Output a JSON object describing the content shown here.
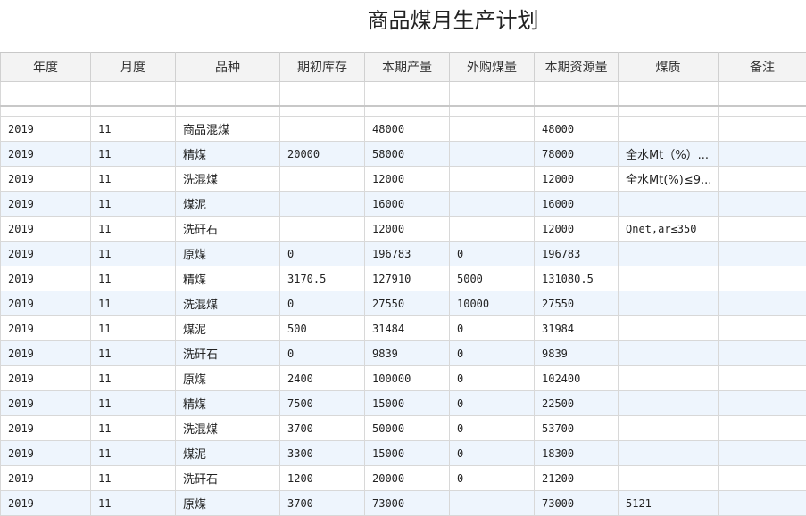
{
  "title": "商品煤月生产计划",
  "columns": [
    "年度",
    "月度",
    "品种",
    "期初库存",
    "本期产量",
    "外购煤量",
    "本期资源量",
    "煤质",
    "备注"
  ],
  "rows": [
    [
      "2019",
      "11",
      "商品混煤",
      "",
      "48000",
      "",
      "48000",
      "",
      ""
    ],
    [
      "2019",
      "11",
      "精煤",
      "20000",
      "58000",
      "",
      "78000",
      "全水Mt（%）...",
      ""
    ],
    [
      "2019",
      "11",
      "洗混煤",
      "",
      "12000",
      "",
      "12000",
      "全水Mt(%)≤9...",
      ""
    ],
    [
      "2019",
      "11",
      "煤泥",
      "",
      "16000",
      "",
      "16000",
      "",
      ""
    ],
    [
      "2019",
      "11",
      "洗矸石",
      "",
      "12000",
      "",
      "12000",
      "Qnet,ar≤350",
      ""
    ],
    [
      "2019",
      "11",
      "原煤",
      "0",
      "196783",
      "0",
      "196783",
      "",
      ""
    ],
    [
      "2019",
      "11",
      "精煤",
      "3170.5",
      "127910",
      "5000",
      "131080.5",
      "",
      ""
    ],
    [
      "2019",
      "11",
      "洗混煤",
      "0",
      "27550",
      "10000",
      "27550",
      "",
      ""
    ],
    [
      "2019",
      "11",
      "煤泥",
      "500",
      "31484",
      "0",
      "31984",
      "",
      ""
    ],
    [
      "2019",
      "11",
      "洗矸石",
      "0",
      "9839",
      "0",
      "9839",
      "",
      ""
    ],
    [
      "2019",
      "11",
      "原煤",
      "2400",
      "100000",
      "0",
      "102400",
      "",
      ""
    ],
    [
      "2019",
      "11",
      "精煤",
      "7500",
      "15000",
      "0",
      "22500",
      "",
      ""
    ],
    [
      "2019",
      "11",
      "洗混煤",
      "3700",
      "50000",
      "0",
      "53700",
      "",
      ""
    ],
    [
      "2019",
      "11",
      "煤泥",
      "3300",
      "15000",
      "0",
      "18300",
      "",
      ""
    ],
    [
      "2019",
      "11",
      "洗矸石",
      "1200",
      "20000",
      "0",
      "21200",
      "",
      ""
    ],
    [
      "2019",
      "11",
      "原煤",
      "3700",
      "73000",
      "",
      "73000",
      "5121",
      ""
    ]
  ]
}
